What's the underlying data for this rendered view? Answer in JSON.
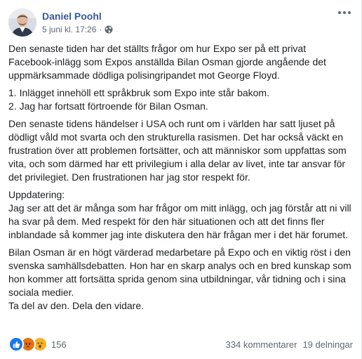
{
  "post": {
    "author": "Daniel Poohl",
    "timestamp": "5 juni kl. 17:26",
    "separator": "·",
    "privacy_icon": "globe-icon",
    "menu_icon": "more-options-icon"
  },
  "body": {
    "paragraphs": [
      "Den senaste tiden har det ställts frågor om hur Expo ser på ett privat Facebook-inlägg som Expos anställda Bilan Osman gjorde angående det uppmärksammade dödliga polisingripandet mot George Floyd.",
      "1. Inlägget innehöll ett språkbruk som Expo inte står bakom.\n2. Jag har fortsatt förtroende för Bilan Osman.",
      "Den senaste tidens händelser i USA och runt om i världen har satt ljuset på dödligt våld mot svarta och den strukturella rasismen. Det har också väckt en frustration över att problemen fortsätter, och att människor som uppfattas som vita, och som därmed har ett privilegium i alla delar av livet, inte tar ansvar för det privilegiet. Den frustrationen har jag stor respekt för.",
      "Uppdatering:\nJag ser att det är många som har frågor om mitt inlägg, och jag förstår att ni vill ha svar på dem. Med respekt för den här situationen och att det finns fler inblandade så kommer jag inte diskutera den här frågan mer i det här forumet.",
      "Bilan Osman är en högt värderad medarbetare på Expo och en viktig röst i den svenska samhällsdebatten. Hon har en skarp analys och en bred kunskap som hon kommer att fortsätta sprida genom sina utbildningar, vår tidning och i sina sociala medier.\nTa del av den. Dela den vidare."
    ]
  },
  "footer": {
    "reaction_icons": [
      "like-icon",
      "angry-icon",
      "wow-icon"
    ],
    "reaction_count": "156",
    "comments": "334 kommentarer",
    "shares": "19 delningar"
  },
  "colors": {
    "author": "#385898",
    "meta": "#606770",
    "text": "#1c1e21",
    "like": "#1877f2",
    "angry": "#e9710f",
    "wow": "#f7b125"
  }
}
